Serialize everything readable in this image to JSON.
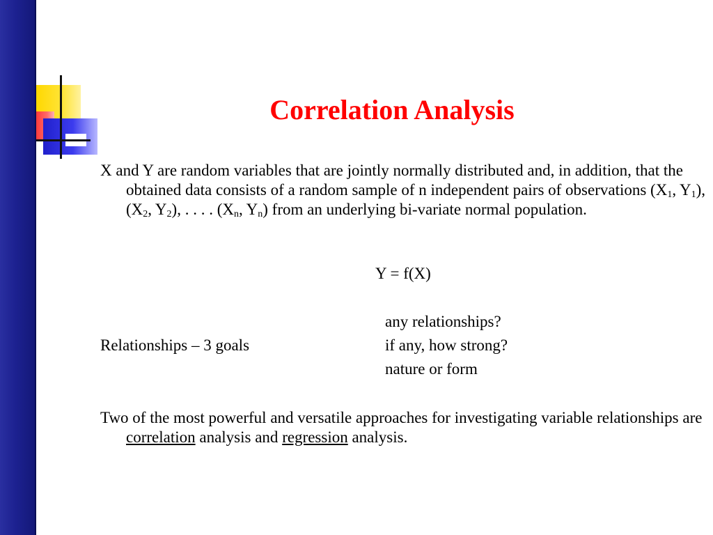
{
  "title": "Correlation Analysis",
  "paragraph1": {
    "text_a": "X and Y are random variables that are jointly normally distributed and, in addition, that the obtained data consists of a random sample of n independent pairs of observations (X",
    "sub_1a": "1",
    "text_b": ", Y",
    "sub_1b": "1",
    "text_c": "), (X",
    "sub_2a": "2",
    "text_d": ", Y",
    "sub_2b": "2",
    "text_e": "), . . . . (X",
    "sub_na": "n",
    "text_f": ", Y",
    "sub_nb": "n",
    "text_g": ") from an underlying bi-variate normal population."
  },
  "formula": "Y = f(X)",
  "relationships": {
    "label": "Relationships – 3 goals",
    "goals": [
      "any relationships?",
      "if any, how strong?",
      "nature or form"
    ]
  },
  "paragraph2": {
    "text_a": "Two of the most powerful and versatile approaches for investigating variable relationships are ",
    "link1": "correlation",
    "text_b": " analysis and ",
    "link2": "regression",
    "text_c": " analysis."
  },
  "colors": {
    "title": "#ff0000",
    "side_bar": "#1c2190",
    "deco_yellow": "#ffd800",
    "deco_red": "#ff3b3b",
    "deco_blue": "#2020cc"
  }
}
